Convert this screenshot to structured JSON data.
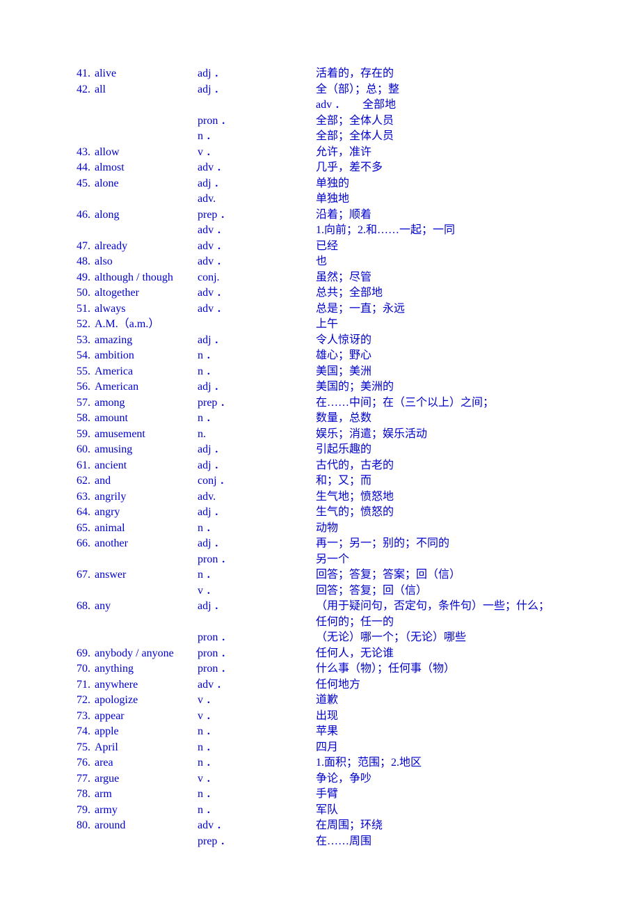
{
  "entries": [
    {
      "num": "41.",
      "word": "alive",
      "rows": [
        {
          "pos": "adj ．",
          "def": "活着的，存在的"
        }
      ]
    },
    {
      "num": "42.",
      "word": "all",
      "rows": [
        {
          "pos": "adj ．",
          "def": "全（部）；总；整"
        },
        {
          "pos": "",
          "def": "adv ．      全部地"
        },
        {
          "pos": "pron ．",
          "def": "全部；全体人员"
        },
        {
          "pos": "n ．",
          "def": "全部；全体人员"
        }
      ]
    },
    {
      "num": "43.",
      "word": "allow",
      "rows": [
        {
          "pos": "v ．",
          "def": "允许，准许"
        }
      ]
    },
    {
      "num": "44.",
      "word": "almost",
      "rows": [
        {
          "pos": "adv ．",
          "def": "几乎，差不多"
        }
      ]
    },
    {
      "num": "45.",
      "word": "alone",
      "rows": [
        {
          "pos": "adj ．",
          "def": "单独的"
        },
        {
          "pos": "adv.",
          "def": "单独地"
        }
      ]
    },
    {
      "num": "46.",
      "word": "along",
      "rows": [
        {
          "pos": "prep ．",
          "def": "沿着；顺着"
        },
        {
          "pos": "adv ．",
          "def": "1.向前；2.和……一起；一同"
        }
      ]
    },
    {
      "num": "47.",
      "word": "already",
      "rows": [
        {
          "pos": "adv ．",
          "def": "已经"
        }
      ]
    },
    {
      "num": "48.",
      "word": "also",
      "rows": [
        {
          "pos": "adv ．",
          "def": "也"
        }
      ]
    },
    {
      "num": "49.",
      "word": "although / though",
      "rows": [
        {
          "pos": "conj.",
          "def": "虽然；尽管"
        }
      ]
    },
    {
      "num": "50.",
      "word": "altogether",
      "rows": [
        {
          "pos": "adv ．",
          "def": "总共；全部地"
        }
      ]
    },
    {
      "num": "51.",
      "word": "always",
      "rows": [
        {
          "pos": "adv ．",
          "def": "总是；一直；永远"
        }
      ]
    },
    {
      "num": "52.",
      "word": "A.M.（a.m.）",
      "rows": [
        {
          "pos": "",
          "def": "上午"
        }
      ]
    },
    {
      "num": "53.",
      "word": "amazing",
      "rows": [
        {
          "pos": "adj ．",
          "def": "令人惊讶的"
        }
      ]
    },
    {
      "num": "54.",
      "word": "ambition",
      "rows": [
        {
          "pos": "n ．",
          "def": "雄心；野心"
        }
      ]
    },
    {
      "num": "55.",
      "word": "America",
      "rows": [
        {
          "pos": "n ．",
          "def": "美国；美洲"
        }
      ]
    },
    {
      "num": "56.",
      "word": "American",
      "rows": [
        {
          "pos": "adj ．",
          "def": "美国的；美洲的"
        }
      ]
    },
    {
      "num": "57.",
      "word": "among",
      "rows": [
        {
          "pos": "prep ．",
          "def": "在……中间；在（三个以上）之间；"
        }
      ]
    },
    {
      "num": "58.",
      "word": "amount",
      "rows": [
        {
          "pos": "n ．",
          "def": "数量，总数"
        }
      ]
    },
    {
      "num": "59.",
      "word": "amusement",
      "rows": [
        {
          "pos": "n.",
          "def": "娱乐；消遣；娱乐活动"
        }
      ]
    },
    {
      "num": "60.",
      "word": "amusing",
      "rows": [
        {
          "pos": "adj ．",
          "def": "引起乐趣的"
        }
      ]
    },
    {
      "num": "61.",
      "word": "ancient",
      "rows": [
        {
          "pos": "adj ．",
          "def": "古代的，古老的"
        }
      ]
    },
    {
      "num": "62.",
      "word": "and",
      "rows": [
        {
          "pos": "conj ．",
          "def": "和；又；而"
        }
      ]
    },
    {
      "num": "63.",
      "word": "angrily",
      "rows": [
        {
          "pos": "adv.",
          "def": "生气地；愤怒地"
        }
      ]
    },
    {
      "num": "64.",
      "word": "angry",
      "rows": [
        {
          "pos": "adj ．",
          "def": "生气的；愤怒的"
        }
      ]
    },
    {
      "num": "65.",
      "word": "animal",
      "rows": [
        {
          "pos": "n ．",
          "def": "动物"
        }
      ]
    },
    {
      "num": "66.",
      "word": "another",
      "rows": [
        {
          "pos": "adj ．",
          "def": "再一；另一；别的；不同的"
        },
        {
          "pos": "pron ．",
          "def": "另一个"
        }
      ]
    },
    {
      "num": "67.",
      "word": "answer",
      "rows": [
        {
          "pos": "n ．",
          "def": "回答；答复；答案；回（信）"
        },
        {
          "pos": "v ．",
          "def": "回答；答复；回（信）"
        }
      ]
    },
    {
      "num": "68.",
      "word": "any",
      "rows": [
        {
          "pos": "adj ．",
          "def": "（用于疑问句，否定句，条件句）一些；什么；"
        },
        {
          "pos": "",
          "def": "",
          "defIndent": "任何的；任一的"
        },
        {
          "pos": "pron ．",
          "def": "（无论）哪一个；（无论）哪些"
        }
      ]
    },
    {
      "num": "69.",
      "word": "anybody / anyone",
      "rows": [
        {
          "pos": "pron ．",
          "def": "任何人，无论谁"
        }
      ]
    },
    {
      "num": "70.",
      "word": "anything",
      "rows": [
        {
          "pos": "pron ．",
          "def": "什么事（物）；任何事（物）"
        }
      ]
    },
    {
      "num": "71.",
      "word": "anywhere",
      "rows": [
        {
          "pos": "adv ．",
          "def": "任何地方"
        }
      ]
    },
    {
      "num": "72.",
      "word": "apologize",
      "rows": [
        {
          "pos": "v ．",
          "def": "道歉"
        }
      ]
    },
    {
      "num": "73.",
      "word": "appear",
      "rows": [
        {
          "pos": "v ．",
          "def": "出现"
        }
      ]
    },
    {
      "num": "74.",
      "word": "apple",
      "rows": [
        {
          "pos": "n ．",
          "def": "苹果"
        }
      ]
    },
    {
      "num": "75.",
      "word": "April",
      "rows": [
        {
          "pos": "n ．",
          "def": "四月"
        }
      ]
    },
    {
      "num": "76.",
      "word": "area",
      "rows": [
        {
          "pos": "n ．",
          "def": "1.面积；范围；2.地区"
        }
      ]
    },
    {
      "num": "77.",
      "word": "argue",
      "rows": [
        {
          "pos": "v ．",
          "def": "争论，争吵"
        }
      ]
    },
    {
      "num": "78.",
      "word": "arm",
      "rows": [
        {
          "pos": "n ．",
          "def": "手臂"
        }
      ]
    },
    {
      "num": "79.",
      "word": "army",
      "rows": [
        {
          "pos": "n ．",
          "def": "军队"
        }
      ]
    },
    {
      "num": "80.",
      "word": "around",
      "rows": [
        {
          "pos": "adv ．",
          "def": "在周围；环绕"
        },
        {
          "pos": "prep ．",
          "def": "在……周围"
        }
      ]
    }
  ]
}
